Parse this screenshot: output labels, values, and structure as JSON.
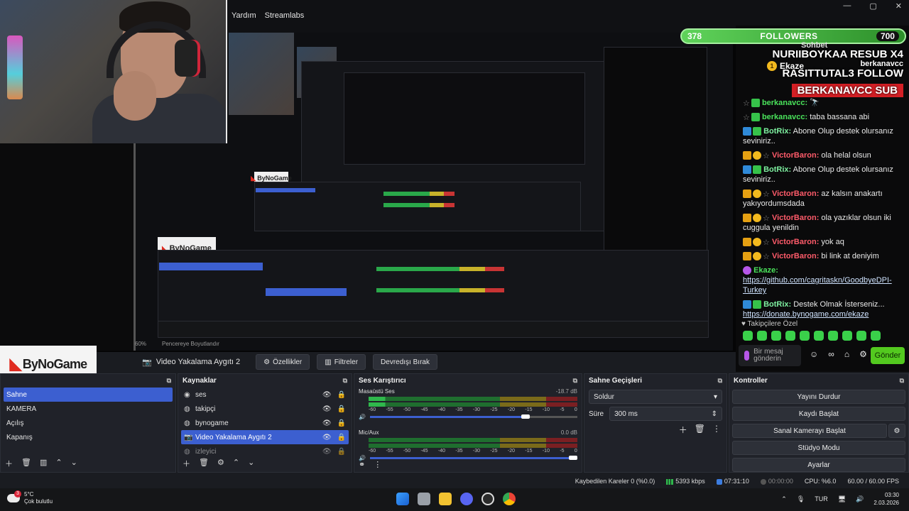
{
  "menubar": {
    "items": [
      "Yardım",
      "Streamlabs"
    ]
  },
  "window_controls": [
    "—",
    "▢",
    "✕"
  ],
  "logo": {
    "text": "ByNoGame"
  },
  "overlay": {
    "followers_left": "378",
    "followers_label": "FOLLOWERS",
    "followers_right": "700",
    "sohbet": "Sohbet",
    "alerts": [
      "NURIIBOYKAA RESUB X4",
      "RASITTUTAL3 FOLLOW",
      "BERKANAVCC SUB"
    ],
    "top_user": "Ekaze",
    "top_user2": "berkanavcc",
    "top_rank": "1",
    "top_num": "3"
  },
  "chat": {
    "messages": [
      {
        "user": "berkanavcc:",
        "text": "🔭",
        "color": "green",
        "badges": [
          "star",
          "green"
        ]
      },
      {
        "user": "berkanavcc:",
        "text": "taba bassana abi",
        "color": "green",
        "badges": [
          "star",
          "green"
        ]
      },
      {
        "user": "BotRix:",
        "text": "Abone Olup destek olursanız seviniriz..",
        "color": "teal",
        "badges": [
          "blue",
          "green"
        ]
      },
      {
        "user": "VictorBaron:",
        "text": "ola helal olsun",
        "color": "red",
        "badges": [
          "gold",
          "coin2",
          "star"
        ]
      },
      {
        "user": "BotRix:",
        "text": "Abone Olup destek olursanız seviniriz..",
        "color": "teal",
        "badges": [
          "blue",
          "green"
        ]
      },
      {
        "user": "VictorBaron:",
        "text": "az kalsın anakartı yakıyordumsdada",
        "color": "red",
        "badges": [
          "gold",
          "coin2",
          "star"
        ]
      },
      {
        "user": "VictorBaron:",
        "text": "ola yazıklar olsun iki cuggula yenildin",
        "color": "red",
        "badges": [
          "gold",
          "coin2",
          "star"
        ]
      },
      {
        "user": "VictorBaron:",
        "text": "yok aq",
        "color": "red",
        "badges": [
          "gold",
          "coin2",
          "star"
        ]
      },
      {
        "user": "VictorBaron:",
        "text": "bi link at deniyim",
        "color": "red",
        "badges": [
          "gold",
          "coin2",
          "star"
        ]
      },
      {
        "user": "Ekaze:",
        "text": "",
        "color": "green",
        "badges": [
          "purple"
        ],
        "link": "https://github.com/cagritaskn/GoodbyeDPI-Turkey"
      },
      {
        "user": "BotRix:",
        "text": "Destek Olmak İsterseniz...",
        "color": "teal",
        "badges": [
          "blue",
          "green"
        ],
        "link": "https://donate.bynogame.com/ekaze"
      }
    ],
    "special_label": "Takipçilere Özel",
    "input_placeholder": "Bir mesaj gönderin",
    "send_label": "Gönder"
  },
  "preview": {
    "zoom": "60%",
    "fit_label": "Pencereye Boyutlandır",
    "source_name": "Video Yakalama Aygıtı 2",
    "buttons": {
      "properties": "Özellikler",
      "filters": "Filtreler",
      "deactivate": "Devredışı Bırak"
    }
  },
  "scenes": {
    "title": "",
    "items": [
      "Sahne",
      "KAMERA",
      "Açılış",
      "Kapanış"
    ],
    "selected": 0
  },
  "sources": {
    "title": "Kaynaklar",
    "items": [
      {
        "name": "ses",
        "icon": "speaker-icon"
      },
      {
        "name": "takipçi",
        "icon": "globe-icon"
      },
      {
        "name": "bynogame",
        "icon": "globe-icon"
      },
      {
        "name": "Video Yakalama Aygıtı 2",
        "icon": "camera-icon"
      },
      {
        "name": "izleyici",
        "icon": "globe-icon"
      }
    ],
    "selected": 3
  },
  "mixer": {
    "title": "Ses Karıştırıcı",
    "channels": [
      {
        "name": "Masaüstü Ses",
        "db": "-18.7 dB",
        "volume": 0.77
      },
      {
        "name": "Mic/Aux",
        "db": "0.0 dB",
        "volume": 1.0
      }
    ],
    "scale": [
      "-60",
      "-55",
      "-50",
      "-45",
      "-40",
      "-35",
      "-30",
      "-25",
      "-20",
      "-15",
      "-10",
      "-5",
      "0"
    ]
  },
  "transitions": {
    "title": "Sahne Geçişleri",
    "selected": "Soldur",
    "duration_label": "Süre",
    "duration_value": "300 ms"
  },
  "controls": {
    "title": "Kontroller",
    "buttons": [
      "Yayını Durdur",
      "Kaydı Başlat",
      "Sanal Kamerayı Başlat",
      "Stüdyo Modu",
      "Ayarlar"
    ]
  },
  "status": {
    "dropped": "Kaybedilen Kareler 0 (%0.0)",
    "bitrate": "5393 kbps",
    "live_time": "07:31:10",
    "rec_time": "00:00:00",
    "cpu": "CPU: %6.0",
    "fps": "60.00 / 60.00 FPS"
  },
  "taskbar": {
    "weather_temp": "5°C",
    "weather_desc": "Çok bulutlu",
    "weather_badge": "3",
    "lang": "TUR",
    "time": "03:30",
    "date": "2.03.2026"
  }
}
